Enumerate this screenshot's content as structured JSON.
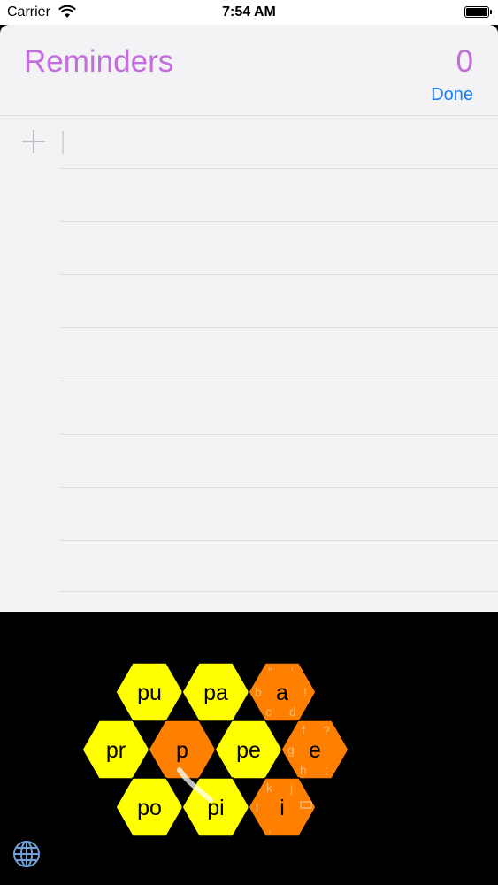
{
  "status": {
    "carrier": "Carrier",
    "time": "7:54 AM"
  },
  "reminders": {
    "title": "Reminders",
    "count": "0",
    "done_label": "Done"
  },
  "keyboard": {
    "keys": [
      {
        "label": "pu",
        "color": "#ffff00"
      },
      {
        "label": "pa",
        "color": "#ffff00"
      },
      {
        "label": "a",
        "color": "#ff7f00"
      },
      {
        "label": "pr",
        "color": "#ffff00"
      },
      {
        "label": "p",
        "color": "#ff7f00"
      },
      {
        "label": "pe",
        "color": "#ffff00"
      },
      {
        "label": "e",
        "color": "#ff7f00"
      },
      {
        "label": "po",
        "color": "#ffff00"
      },
      {
        "label": "pi",
        "color": "#ffff00"
      },
      {
        "label": "i",
        "color": "#ff7f00"
      }
    ],
    "hints": {
      "a": [
        "\"",
        "'",
        "b",
        "!",
        "c",
        "d"
      ],
      "e": [
        "f",
        "?",
        "g",
        "h",
        ":"
      ],
      "i": [
        "k",
        "j",
        "l",
        ","
      ]
    }
  },
  "colors": {
    "accent": "#c36cde",
    "link": "#1a7ff5",
    "key_yellow": "#ffff00",
    "key_orange": "#ff7f00"
  }
}
